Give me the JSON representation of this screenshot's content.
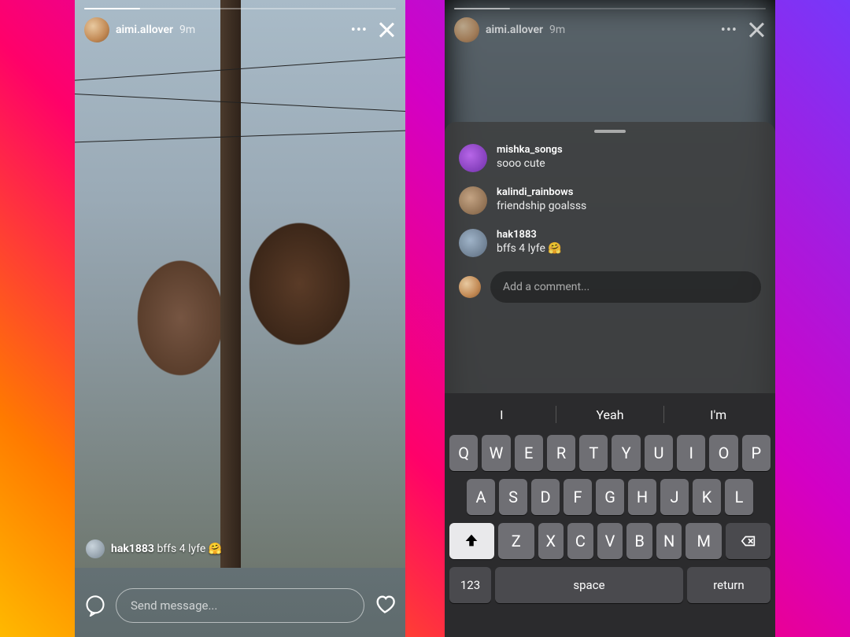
{
  "left": {
    "username": "aimi.allover",
    "time": "9m",
    "overlay_comment": {
      "user": "hak1883",
      "text": "bffs 4 lyfe",
      "emoji": "🤗"
    },
    "message_placeholder": "Send message..."
  },
  "right": {
    "username": "aimi.allover",
    "time": "9m",
    "comments": [
      {
        "user": "mishka_songs",
        "text": "sooo cute"
      },
      {
        "user": "kalindi_rainbows",
        "text": "friendship goalsss"
      },
      {
        "user": "hak1883",
        "text": "bffs 4 lyfe",
        "emoji": "🤗"
      }
    ],
    "add_placeholder": "Add a comment...",
    "suggestions": [
      "I",
      "Yeah",
      "I'm"
    ],
    "keyboard": {
      "row1": [
        "Q",
        "W",
        "E",
        "R",
        "T",
        "Y",
        "U",
        "I",
        "O",
        "P"
      ],
      "row2": [
        "A",
        "S",
        "D",
        "F",
        "G",
        "H",
        "J",
        "K",
        "L"
      ],
      "row3": [
        "Z",
        "X",
        "C",
        "V",
        "B",
        "N",
        "M"
      ],
      "numbers": "123",
      "space": "space",
      "return": "return"
    }
  }
}
